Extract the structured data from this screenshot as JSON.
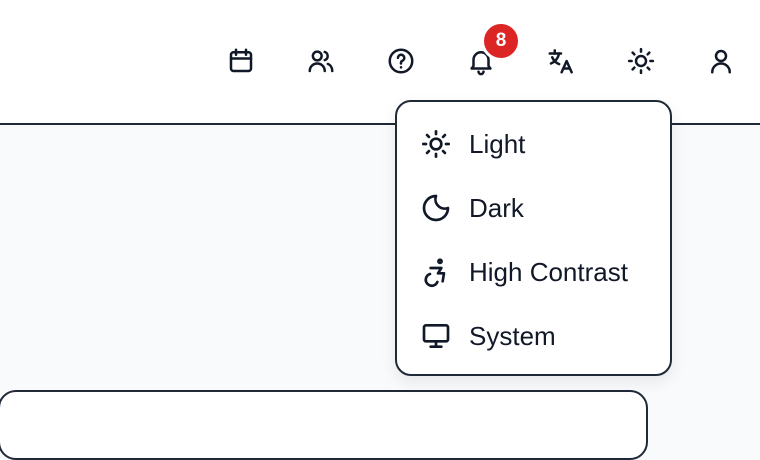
{
  "header": {
    "icons": [
      {
        "name": "calendar-icon"
      },
      {
        "name": "users-icon"
      },
      {
        "name": "help-icon"
      },
      {
        "name": "bell-icon"
      },
      {
        "name": "translate-icon"
      },
      {
        "name": "sun-icon"
      },
      {
        "name": "user-icon"
      }
    ],
    "notification_count": "8",
    "badge_color": "#dc2626"
  },
  "theme_menu": {
    "items": [
      {
        "label": "Light",
        "icon": "sun-icon"
      },
      {
        "label": "Dark",
        "icon": "moon-icon"
      },
      {
        "label": "High Contrast",
        "icon": "accessibility-icon"
      },
      {
        "label": "System",
        "icon": "monitor-icon"
      }
    ]
  }
}
